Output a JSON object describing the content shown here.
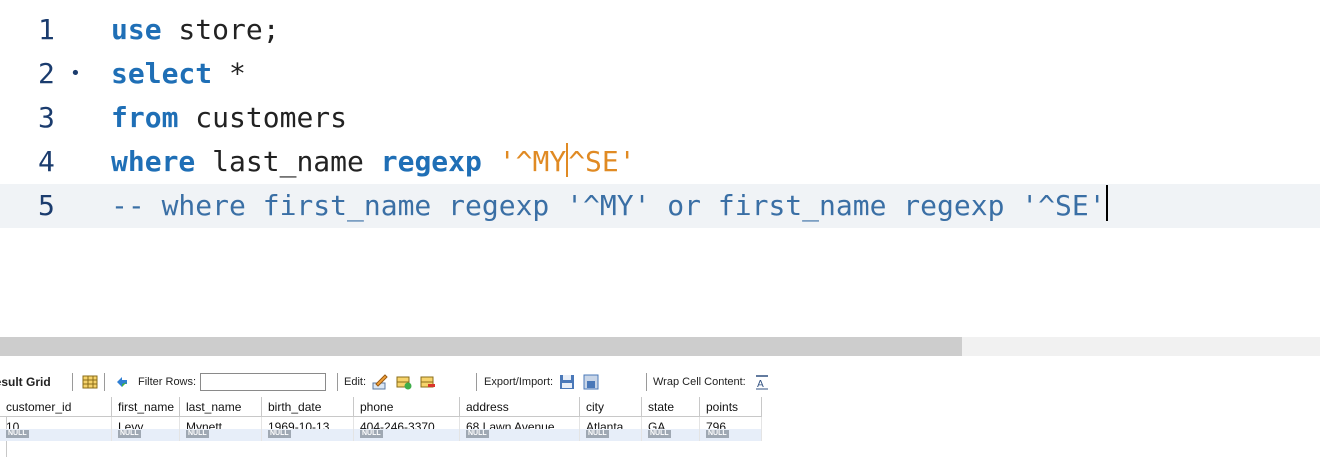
{
  "editor": {
    "lines": [
      {
        "num": "1",
        "marker": "",
        "tokens": [
          {
            "t": "kw",
            "v": "use"
          },
          {
            "t": "plain",
            "v": " store;"
          }
        ]
      },
      {
        "num": "2",
        "marker": "•",
        "tokens": [
          {
            "t": "kw",
            "v": "select"
          },
          {
            "t": "plain",
            "v": " *"
          }
        ]
      },
      {
        "num": "3",
        "marker": "",
        "tokens": [
          {
            "t": "kw",
            "v": "from"
          },
          {
            "t": "plain",
            "v": " customers"
          }
        ]
      },
      {
        "num": "4",
        "marker": "",
        "tokens": [
          {
            "t": "kw",
            "v": "where"
          },
          {
            "t": "plain",
            "v": " last_name "
          },
          {
            "t": "kw",
            "v": "regexp"
          },
          {
            "t": "plain",
            "v": " "
          },
          {
            "t": "str",
            "v": "'^MY"
          },
          {
            "t": "strcaret",
            "v": ""
          },
          {
            "t": "str",
            "v": "^SE'"
          }
        ]
      },
      {
        "num": "5",
        "marker": "",
        "tokens": [
          {
            "t": "cmt",
            "v": "-- where first_name regexp '^MY' or first_name regexp '^SE'"
          },
          {
            "t": "caret",
            "v": ""
          }
        ]
      }
    ]
  },
  "toolbar": {
    "result_grid": "Result Grid",
    "filter_rows": "Filter Rows:",
    "filter_value": "",
    "edit": "Edit:",
    "export_import": "Export/Import:",
    "wrap_cell": "Wrap Cell Content:"
  },
  "grid": {
    "columns": [
      "customer_id",
      "first_name",
      "last_name",
      "birth_date",
      "phone",
      "address",
      "city",
      "state",
      "points"
    ],
    "rows": [
      [
        "10",
        "Levy",
        "Mynett",
        "1969-10-13",
        "404-246-3370",
        "68 Lawn Avenue",
        "Atlanta",
        "GA",
        "796"
      ]
    ],
    "null_label": "NULL"
  },
  "colors": {
    "keyword": "#1f6fb6",
    "string": "#e08a23",
    "comment": "#3a6fa5",
    "line_number": "#1b3c6e"
  }
}
